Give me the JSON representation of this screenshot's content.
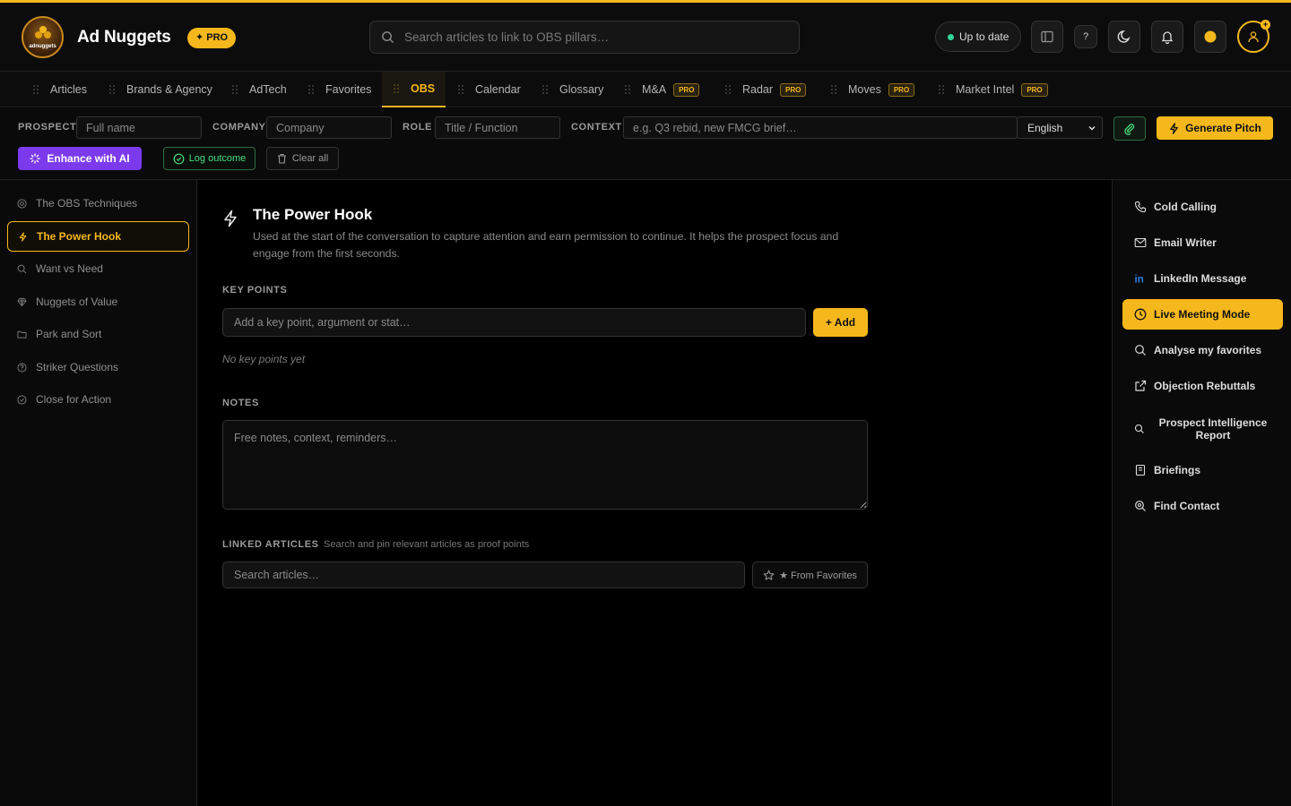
{
  "header": {
    "app_title": "Ad Nuggets",
    "logo_text": "adnuggets",
    "pro_badge": "✦ PRO",
    "search_placeholder": "Search articles to link to OBS pillars…",
    "status_text": "Up to date",
    "help_label": "?",
    "accent_color": "#f5b81c",
    "status_color": "#34d399",
    "icons": [
      "search-icon",
      "sidebar-toggle-icon",
      "help-icon",
      "moon-icon",
      "bell-icon",
      "coin-icon",
      "user-icon"
    ]
  },
  "nav": {
    "tabs": [
      {
        "label": "Articles",
        "badge": "",
        "active": false
      },
      {
        "label": "Brands & Agency",
        "badge": "",
        "active": false
      },
      {
        "label": "AdTech",
        "badge": "",
        "active": false
      },
      {
        "label": "Favorites",
        "badge": "",
        "active": false
      },
      {
        "label": "OBS",
        "badge": "",
        "active": true
      },
      {
        "label": "Calendar",
        "badge": "",
        "active": false
      },
      {
        "label": "Glossary",
        "badge": "",
        "active": false
      },
      {
        "label": "M&A",
        "badge": "PRO",
        "active": false
      },
      {
        "label": "Radar",
        "badge": "PRO",
        "active": false
      },
      {
        "label": "Moves",
        "badge": "PRO",
        "active": false
      },
      {
        "label": "Market Intel",
        "badge": "PRO",
        "active": false
      }
    ]
  },
  "prospect": {
    "prospect_label": "PROSPECT",
    "prospect_placeholder": "Full name",
    "company_label": "COMPANY",
    "company_placeholder": "Company",
    "role_label": "ROLE",
    "role_placeholder": "Title / Function",
    "context_label": "CONTEXT",
    "context_placeholder": "e.g. Q3 rebid, new FMCG brief…",
    "language": "English",
    "generate_label": "Generate Pitch",
    "enhance_label": "Enhance with AI",
    "log_outcome_label": "Log outcome",
    "clear_label": "Clear all",
    "enhance_color": "#7c3aed",
    "log_color": "#4ade80"
  },
  "left_sidebar": {
    "items": [
      {
        "label": "The OBS Techniques",
        "icon": "target-icon",
        "active": false
      },
      {
        "label": "The Power Hook",
        "icon": "bolt-icon",
        "active": true
      },
      {
        "label": "Want vs Need",
        "icon": "search-icon",
        "active": false
      },
      {
        "label": "Nuggets of Value",
        "icon": "gem-icon",
        "active": false
      },
      {
        "label": "Park and Sort",
        "icon": "folder-icon",
        "active": false
      },
      {
        "label": "Striker Questions",
        "icon": "question-icon",
        "active": false
      },
      {
        "label": "Close for Action",
        "icon": "check-circle-icon",
        "active": false
      }
    ]
  },
  "main": {
    "title": "The Power Hook",
    "description": "Used at the start of the conversation to capture attention and earn permission to continue. It helps the prospect focus and engage from the first seconds.",
    "key_points_label": "KEY POINTS",
    "key_point_placeholder": "Add a key point, argument or stat…",
    "add_label": "+ Add",
    "empty_text": "No key points yet",
    "notes_label": "NOTES",
    "notes_placeholder": "Free notes, context, reminders…",
    "linked_label": "LINKED ARTICLES",
    "linked_hint": "Search and pin relevant articles as proof points",
    "linked_search_placeholder": "Search articles…",
    "from_favorites_label": "★ From Favorites"
  },
  "right_sidebar": {
    "items": [
      {
        "label": "Cold Calling",
        "icon": "phone-icon",
        "active": false
      },
      {
        "label": "Email Writer",
        "icon": "mail-icon",
        "active": false
      },
      {
        "label": "LinkedIn Message",
        "icon": "linkedin-icon",
        "active": false
      },
      {
        "label": "Live Meeting Mode",
        "icon": "clock-icon",
        "active": true
      },
      {
        "label": "Analyse my favorites",
        "icon": "search-icon",
        "active": false
      },
      {
        "label": "Objection Rebuttals",
        "icon": "external-link-icon",
        "active": false
      },
      {
        "label": "Prospect Intelligence Report",
        "icon": "search-icon",
        "active": false
      },
      {
        "label": "Briefings",
        "icon": "book-icon",
        "active": false
      },
      {
        "label": "Find Contact",
        "icon": "search-icon",
        "active": false
      }
    ]
  }
}
